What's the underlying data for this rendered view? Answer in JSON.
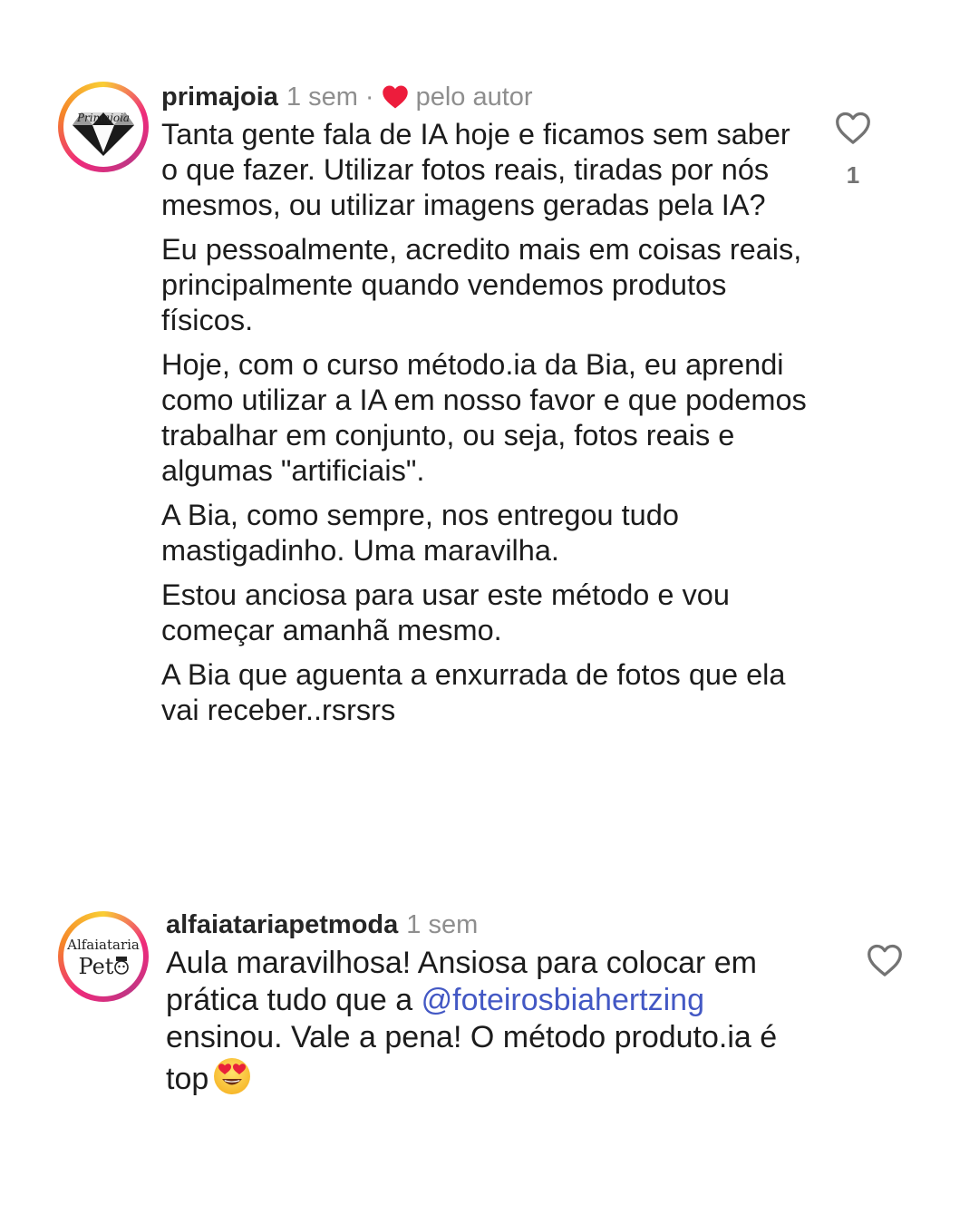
{
  "comments": [
    {
      "username": "primajoia",
      "time": "1 sem",
      "separator": "·",
      "author_badge": "pelo autor",
      "avatar_text": "Primajoia",
      "like_count": "1",
      "paragraphs": [
        "Tanta gente fala de IA hoje e ficamos sem saber o que fazer. Utilizar fotos reais, tiradas por nós mesmos, ou utilizar imagens geradas pela IA?",
        "Eu pessoalmente, acredito mais em coisas reais, principalmente quando vendemos produtos físicos.",
        "Hoje, com o curso método.ia da Bia, eu aprendi como  utilizar a IA em nosso favor e que podemos trabalhar em conjunto, ou seja,  fotos reais e algumas \"artificiais\".",
        "A Bia, como sempre, nos entregou tudo mastigadinho.  Uma maravilha.",
        "Estou anciosa para usar este método e vou começar amanhã mesmo.",
        "A Bia que aguenta a enxurrada de fotos que ela vai receber..rsrsrs"
      ]
    },
    {
      "username": "alfaiatariapetmoda",
      "time": "1 sem",
      "avatar_text_1": "Alfaiataria",
      "avatar_text_2": "Pet",
      "text_before": "Aula maravilhosa! Ansiosa para colocar em prática tudo que a ",
      "mention": "@foteirosbiahertzing",
      "text_after": " ensinou. Vale a pena! O método produto.ia é top"
    }
  ],
  "icons": {
    "author_heart": "heart-filled-icon",
    "like": "heart-outline-icon",
    "emoji": "heart-eyes-emoji-icon"
  },
  "colors": {
    "author_heart": "#ed1c3c",
    "mention": "#4358c4",
    "muted": "#8e8e8e"
  }
}
